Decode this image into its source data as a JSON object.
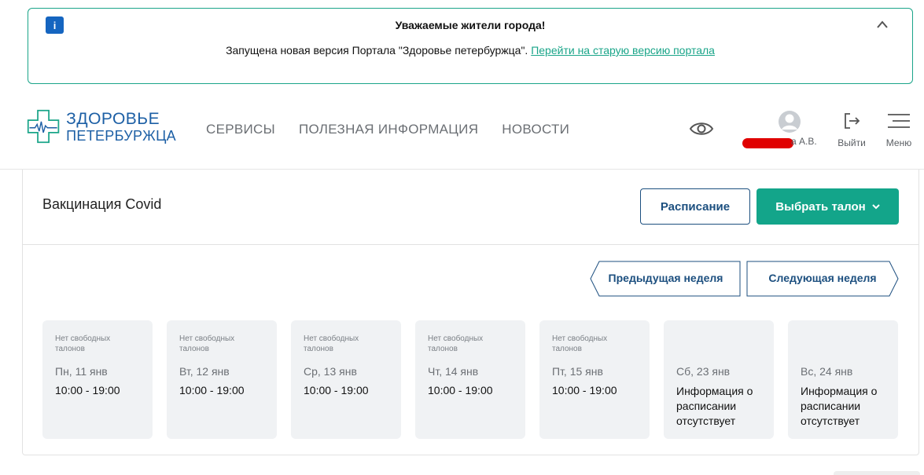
{
  "notice": {
    "badge": "i",
    "title": "Уважаемые жители города!",
    "text": "Запущена новая версия Портала \"Здоровье петербуржца\".",
    "link": "Перейти на старую версию портала"
  },
  "logo": {
    "line1": "ЗДОРОВЬЕ",
    "line2": "ПЕТЕРБУРЖЦА"
  },
  "nav": [
    {
      "label": "СЕРВИСЫ"
    },
    {
      "label": "ПОЛЕЗНАЯ ИНФОРМАЦИЯ"
    },
    {
      "label": "НОВОСТИ"
    }
  ],
  "user": {
    "name_visible": "а А.В."
  },
  "actions": {
    "logout": "Выйти",
    "menu": "Меню"
  },
  "card": {
    "title": "Вакцинация Covid",
    "schedule_button": "Расписание",
    "select_button": "Выбрать талон",
    "prev_week": "Предыдущая неделя",
    "next_week": "Следующая неделя"
  },
  "days": [
    {
      "note": "Нет свободных талонов",
      "date": "Пн, 11 янв",
      "time": "10:00 - 19:00"
    },
    {
      "note": "Нет свободных талонов",
      "date": "Вт, 12 янв",
      "time": "10:00 - 19:00"
    },
    {
      "note": "Нет свободных талонов",
      "date": "Ср, 13 янв",
      "time": "10:00 - 19:00"
    },
    {
      "note": "Нет свободных талонов",
      "date": "Чт, 14 янв",
      "time": "10:00 - 19:00"
    },
    {
      "note": "Нет свободных талонов",
      "date": "Пт, 15 янв",
      "time": "10:00 - 19:00"
    },
    {
      "note": "",
      "date": "Сб, 23 янв",
      "info": "Информация о расписании отсутствует"
    },
    {
      "note": "",
      "date": "Вс, 24 янв",
      "info": "Информация о расписании отсутствует"
    }
  ],
  "colors": {
    "accent": "#13a58a",
    "brand": "#1c5fa5",
    "dark_blue": "#1c4f7f",
    "redaction": "#e00000"
  }
}
